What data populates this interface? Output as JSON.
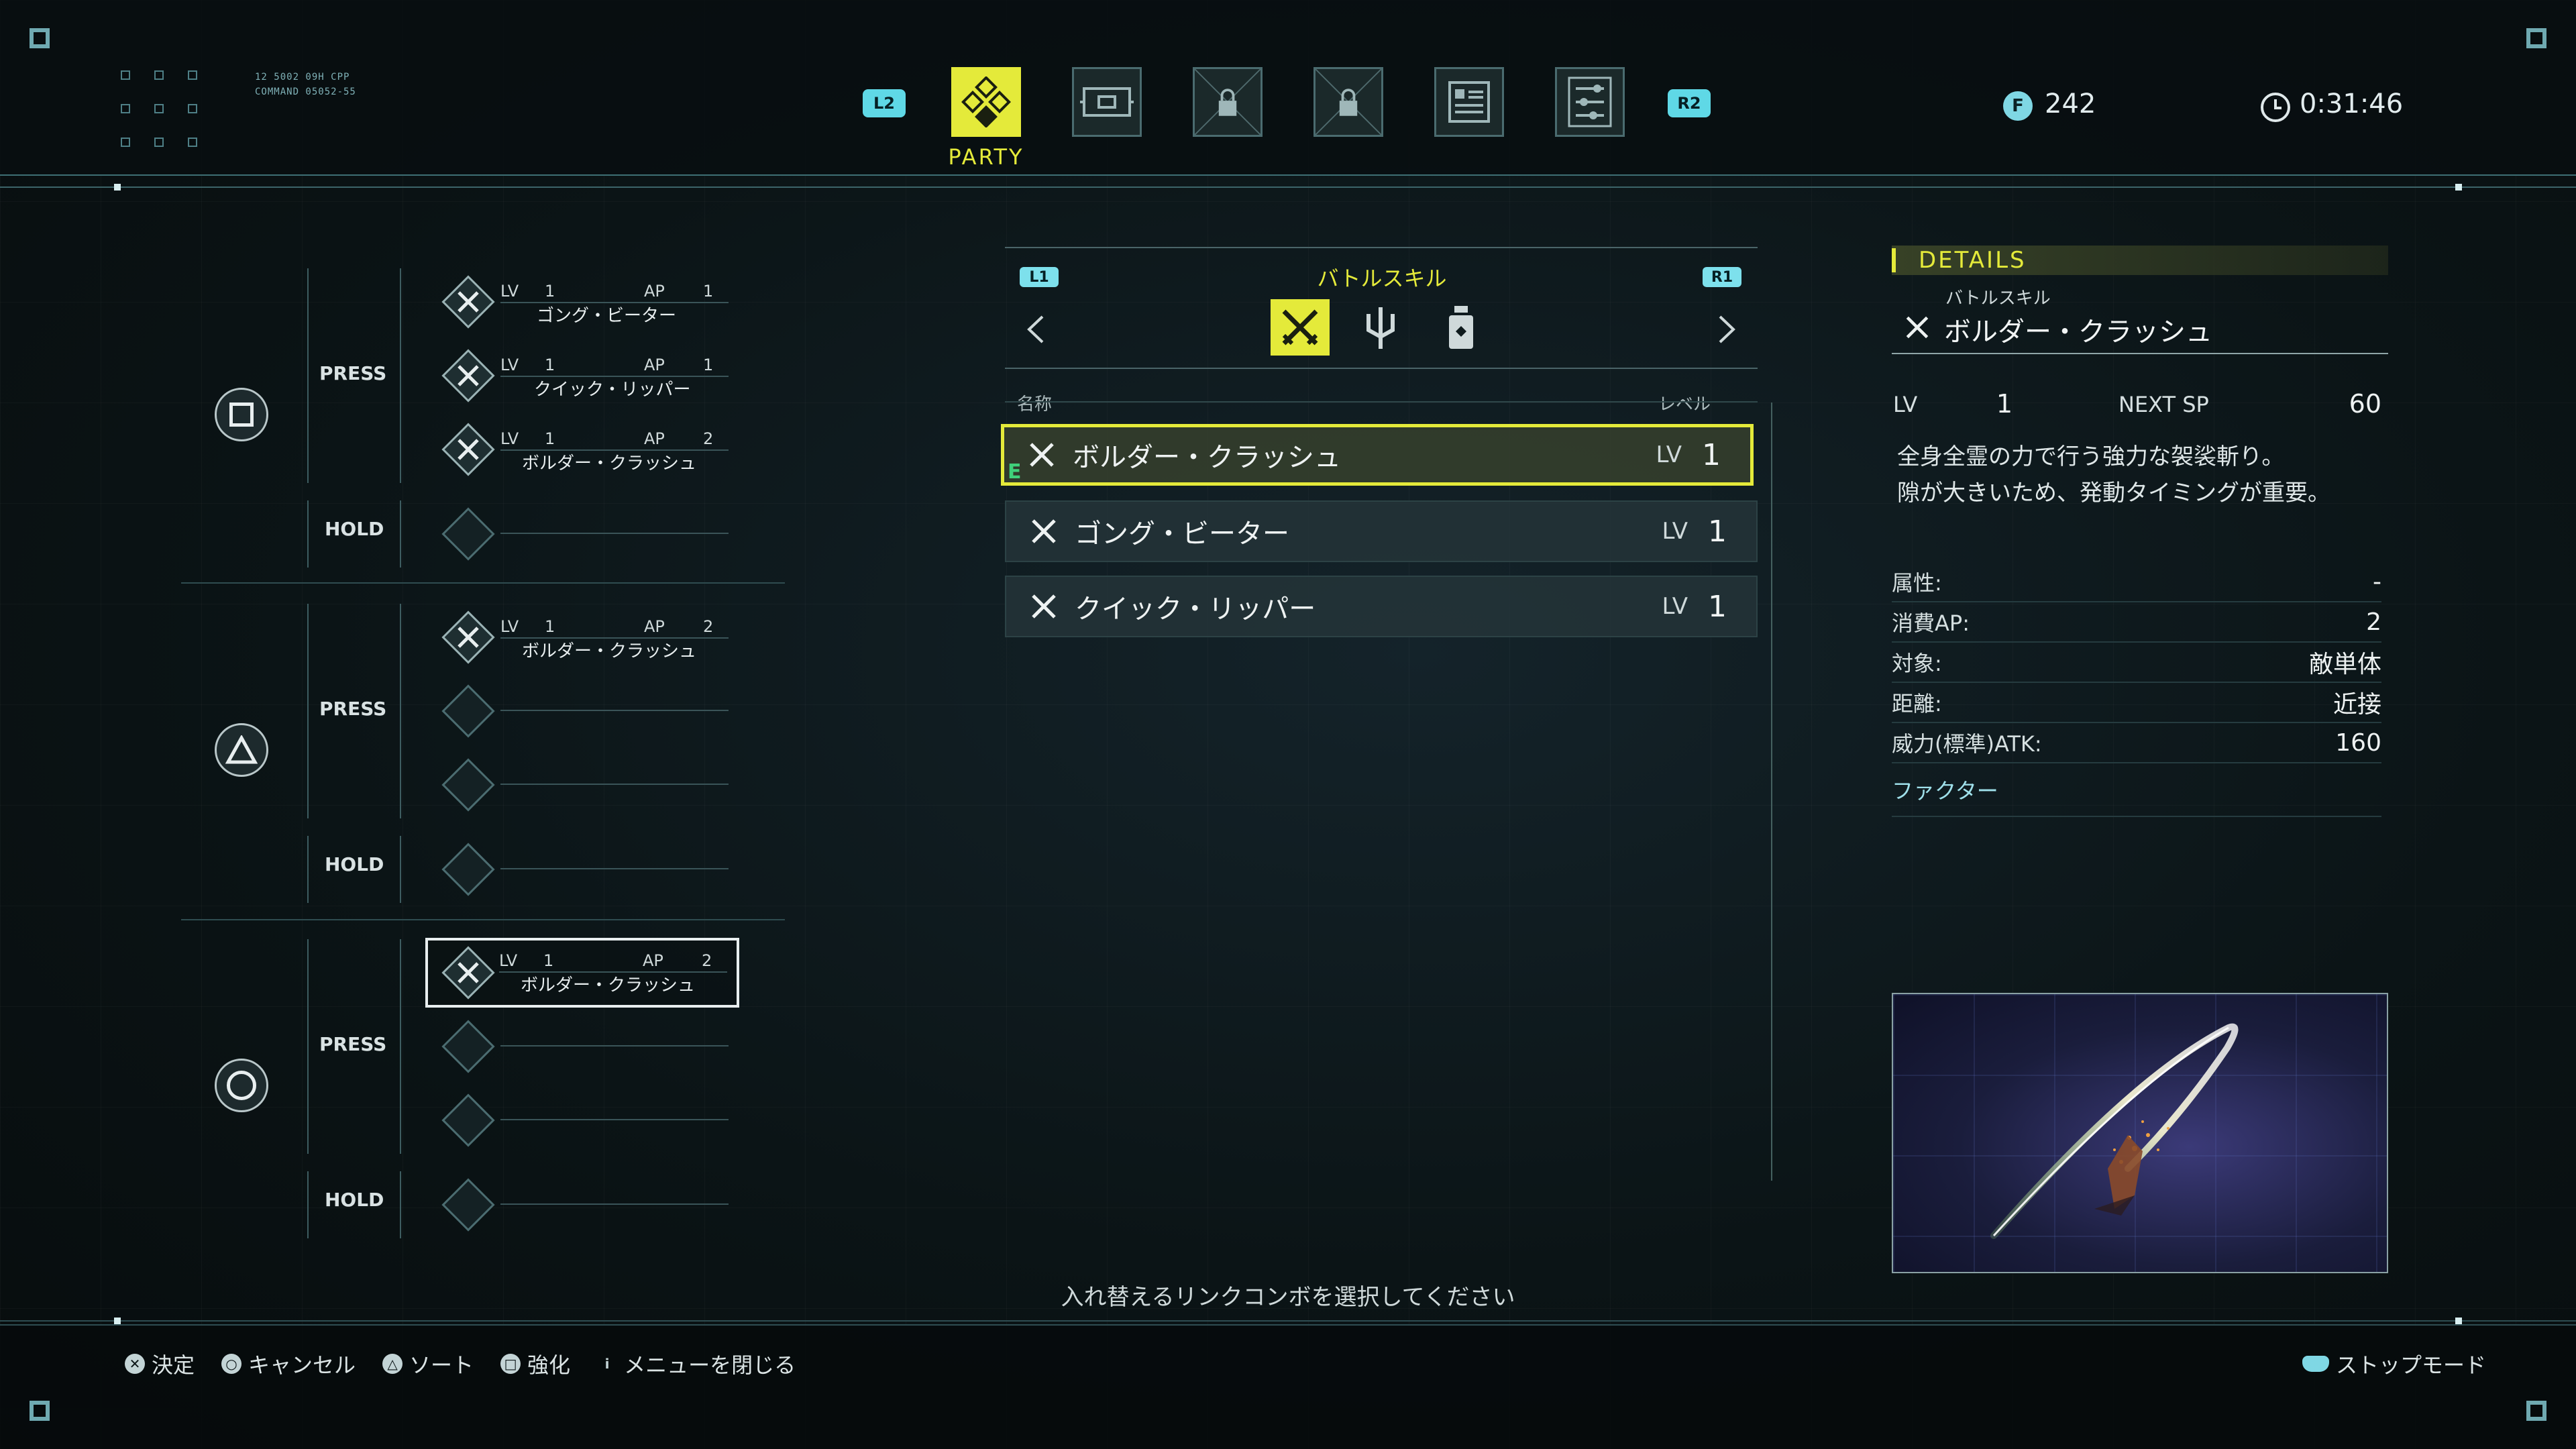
{
  "header": {
    "sys_line1": "12 5002 09H CPP",
    "sys_line2": "COMMAND 05052-55",
    "left_shoulder": "L2",
    "right_shoulder": "R2",
    "active_tab_label": "PARTY",
    "tabs": [
      {
        "icon": "party-icon",
        "active": true
      },
      {
        "icon": "equipment-icon",
        "active": false
      },
      {
        "icon": "lock-icon",
        "active": false
      },
      {
        "icon": "lock-icon",
        "active": false
      },
      {
        "icon": "report-icon",
        "active": false
      },
      {
        "icon": "settings-icon",
        "active": false
      }
    ],
    "currency_symbol": "F",
    "currency": "242",
    "time": "0:31:46"
  },
  "combo": {
    "press_label": "PRESS",
    "hold_label": "HOLD",
    "lv_label": "LV",
    "ap_label": "AP",
    "groups": [
      {
        "button": "square",
        "slots": [
          {
            "lv": "1",
            "ap": "1",
            "name": "ゴング・ビーター"
          },
          {
            "lv": "1",
            "ap": "1",
            "name": "クイック・リッパー"
          },
          {
            "lv": "1",
            "ap": "2",
            "name": "ボルダー・クラッシュ"
          }
        ]
      },
      {
        "button": "triangle",
        "slots": [
          {
            "lv": "1",
            "ap": "2",
            "name": "ボルダー・クラッシュ"
          }
        ]
      },
      {
        "button": "circle",
        "slots": [
          {
            "lv": "1",
            "ap": "2",
            "name": "ボルダー・クラッシュ"
          }
        ]
      }
    ]
  },
  "skills": {
    "category_title": "バトルスキル",
    "left_tag": "L1",
    "right_tag": "R1",
    "col_name": "名称",
    "col_level": "レベル",
    "lv_label": "LV",
    "marker": "E",
    "rows": [
      {
        "name": "ボルダー・クラッシュ",
        "level": "1",
        "active": true
      },
      {
        "name": "ゴング・ビーター",
        "level": "1",
        "active": false
      },
      {
        "name": "クイック・リッパー",
        "level": "1",
        "active": false
      }
    ]
  },
  "details": {
    "header": "DETAILS",
    "category": "バトルスキル",
    "name": "ボルダー・クラッシュ",
    "lv_label": "LV",
    "lv": "1",
    "next_sp_label": "NEXT SP",
    "next_sp": "60",
    "desc_line1": "全身全霊の力で行う強力な袈裟斬り。",
    "desc_line2": "隙が大きいため、発動タイミングが重要。",
    "stats": [
      {
        "label": "属性:",
        "value": "-"
      },
      {
        "label": "消費AP:",
        "value": "2"
      },
      {
        "label": "対象:",
        "value": "敵単体"
      },
      {
        "label": "距離:",
        "value": "近接"
      },
      {
        "label": "威力(標準)ATK:",
        "value": "160"
      }
    ],
    "factor_label": "ファクター"
  },
  "footer": {
    "instruction": "入れ替えるリンクコンボを選択してください",
    "hints": [
      {
        "glyph": "✕",
        "label": "決定"
      },
      {
        "glyph": "○",
        "label": "キャンセル"
      },
      {
        "glyph": "△",
        "label": "ソート"
      },
      {
        "glyph": "□",
        "label": "強化"
      },
      {
        "glyph": "i",
        "label": "メニューを閉じる"
      }
    ],
    "stop_mode": "ストップモード"
  }
}
